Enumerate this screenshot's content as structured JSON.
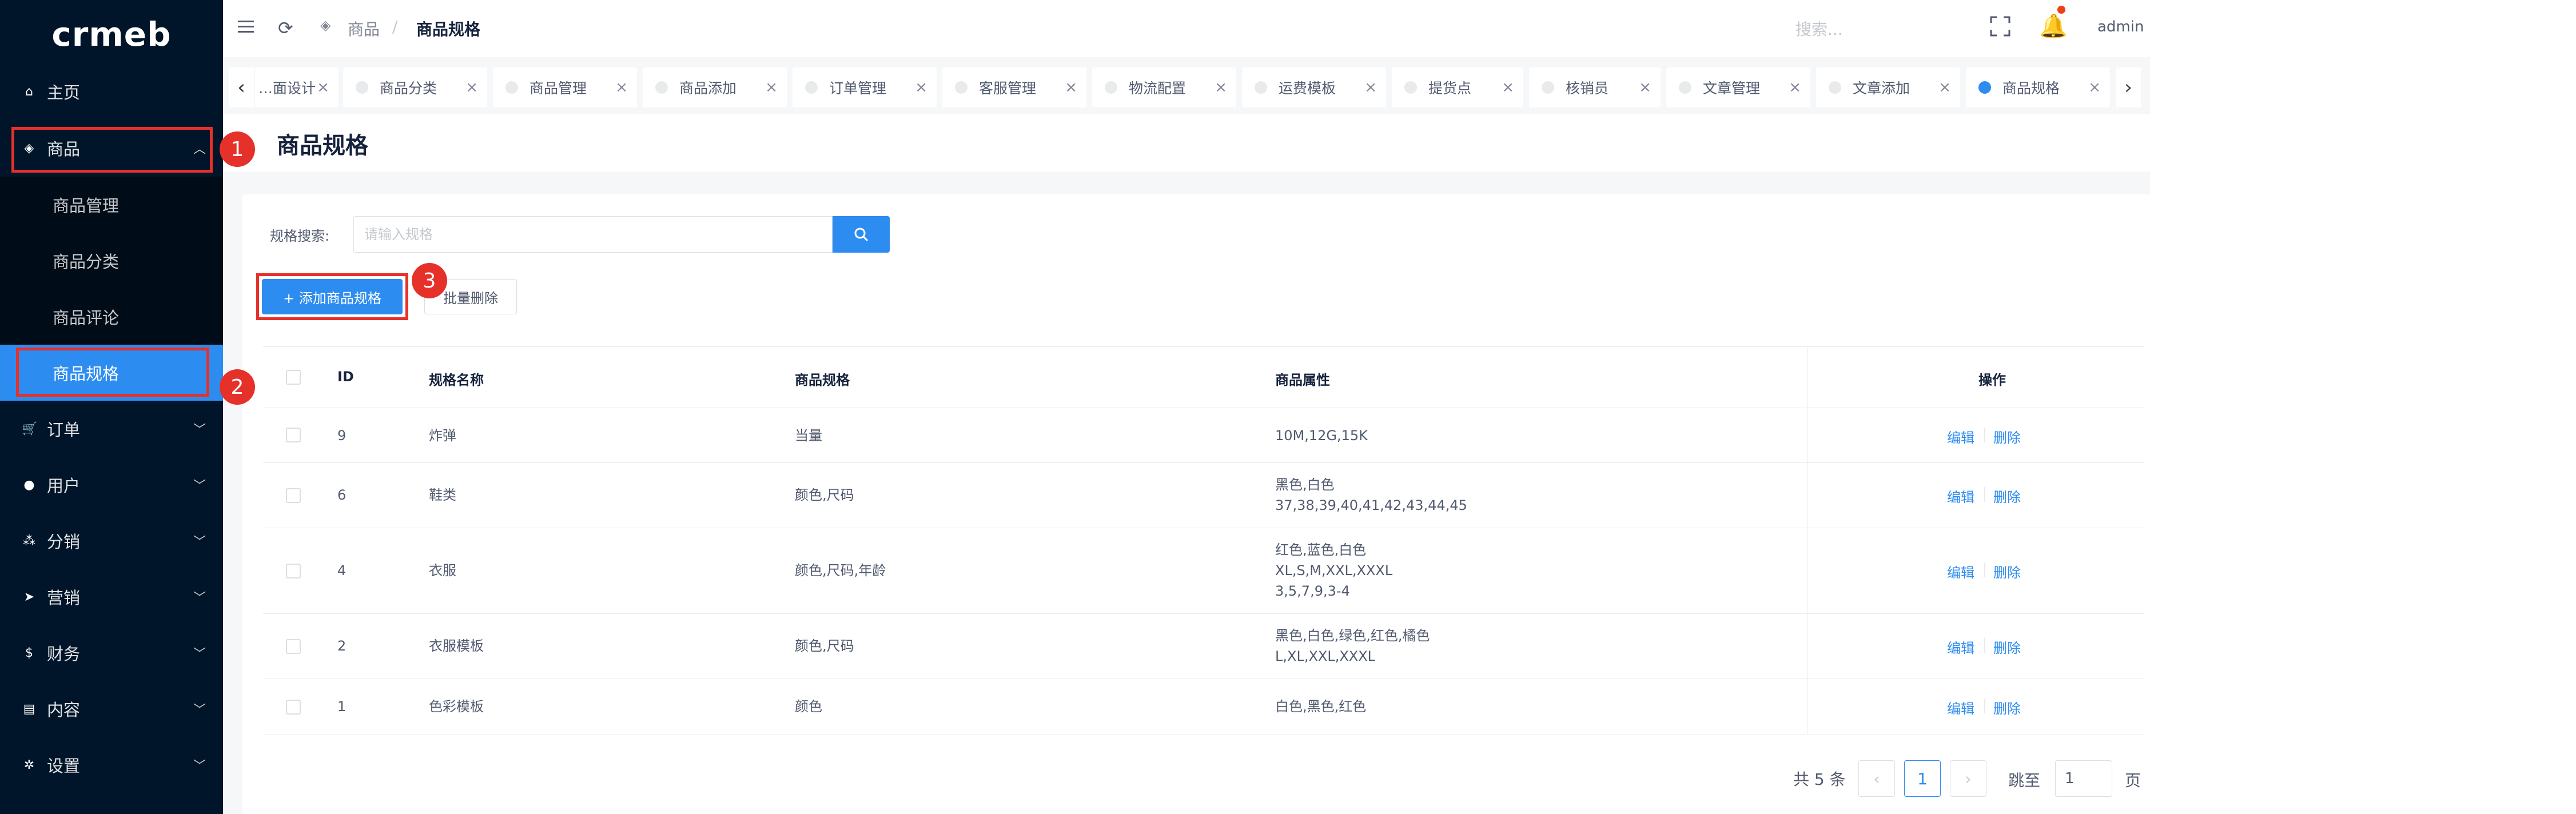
{
  "app": {
    "logo": "crmeb"
  },
  "sidebar": {
    "items": [
      {
        "label": "主页",
        "icon": "home-icon"
      },
      {
        "label": "商品",
        "icon": "shop-icon"
      },
      {
        "label": "订单",
        "icon": "cart-icon"
      },
      {
        "label": "用户",
        "icon": "user-icon"
      },
      {
        "label": "分销",
        "icon": "team-icon"
      },
      {
        "label": "营销",
        "icon": "send-icon"
      },
      {
        "label": "财务",
        "icon": "dollar-icon"
      },
      {
        "label": "内容",
        "icon": "book-icon"
      },
      {
        "label": "设置",
        "icon": "gear-icon"
      }
    ],
    "submenu": [
      "商品管理",
      "商品分类",
      "商品评论",
      "商品规格"
    ],
    "active_sub": "商品规格"
  },
  "header": {
    "breadcrumb_parent": "商品",
    "breadcrumb_sep": "/",
    "breadcrumb_current": "商品规格",
    "search_placeholder": "搜索...",
    "user": "admin"
  },
  "tabs": [
    {
      "label": "…面设计"
    },
    {
      "label": "商品分类"
    },
    {
      "label": "商品管理"
    },
    {
      "label": "商品添加"
    },
    {
      "label": "订单管理"
    },
    {
      "label": "客服管理"
    },
    {
      "label": "物流配置"
    },
    {
      "label": "运费模板"
    },
    {
      "label": "提货点"
    },
    {
      "label": "核销员"
    },
    {
      "label": "文章管理"
    },
    {
      "label": "文章添加"
    },
    {
      "label": "商品规格",
      "active": true
    }
  ],
  "page": {
    "title": "商品规格",
    "search_label": "规格搜索:",
    "search_placeholder": "请输入规格",
    "add_button": "+ 添加商品规格",
    "batch_delete": "批量删除"
  },
  "table": {
    "columns": [
      "ID",
      "规格名称",
      "商品规格",
      "商品属性",
      "操作"
    ],
    "rows": [
      {
        "id": "9",
        "name": "炸弹",
        "spec": "当量",
        "attrs": [
          "10M,12G,15K"
        ]
      },
      {
        "id": "6",
        "name": "鞋类",
        "spec": "颜色,尺码",
        "attrs": [
          "黑色,白色",
          "37,38,39,40,41,42,43,44,45"
        ]
      },
      {
        "id": "4",
        "name": "衣服",
        "spec": "颜色,尺码,年龄",
        "attrs": [
          "红色,蓝色,白色",
          "XL,S,M,XXL,XXXL",
          "3,5,7,9,3-4"
        ]
      },
      {
        "id": "2",
        "name": "衣服模板",
        "spec": "颜色,尺码",
        "attrs": [
          "黑色,白色,绿色,红色,橘色",
          "L,XL,XXL,XXXL"
        ]
      },
      {
        "id": "1",
        "name": "色彩模板",
        "spec": "颜色",
        "attrs": [
          "白色,黑色,红色"
        ]
      }
    ],
    "edit_label": "编辑",
    "delete_label": "删除"
  },
  "pagination": {
    "total_text": "共 5 条",
    "current_page": "1",
    "jump_label": "跳至",
    "jump_value": "1",
    "page_suffix": "页"
  },
  "annotations": [
    "1",
    "2",
    "3"
  ],
  "colors": {
    "primary": "#2d8cf0",
    "sidebar": "#001529",
    "annotation": "#e5312a"
  }
}
